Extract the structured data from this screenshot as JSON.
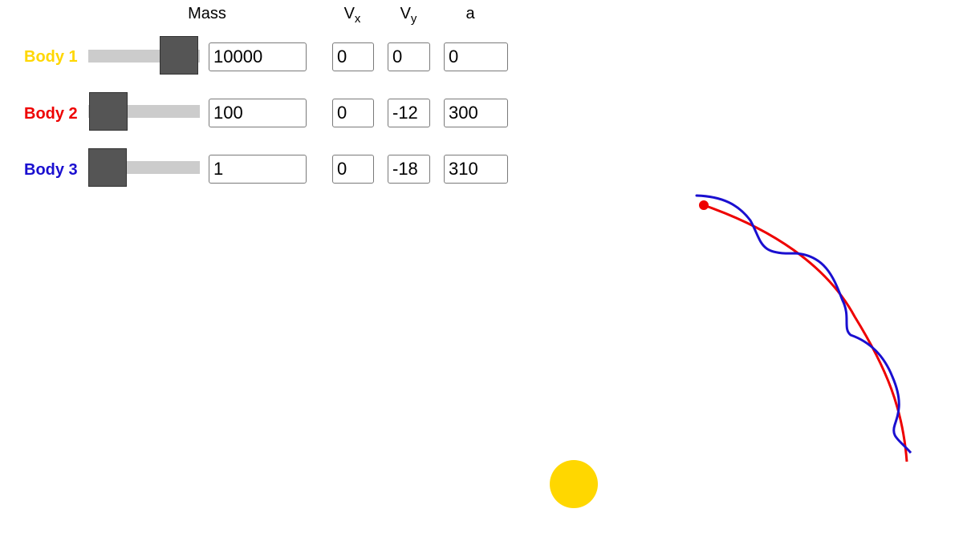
{
  "headers": {
    "mass": "Mass",
    "vx_main": "V",
    "vx_sub": "x",
    "vy_main": "V",
    "vy_sub": "y",
    "a": "a"
  },
  "bodies": [
    {
      "label": "Body 1",
      "color": "#FFD700",
      "mass": "10000",
      "vx": "0",
      "vy": "0",
      "a": "0",
      "mass_slider": 1.0
    },
    {
      "label": "Body 2",
      "color": "#EE0000",
      "mass": "100",
      "vx": "0",
      "vy": "-12",
      "a": "300",
      "mass_slider": 0.0
    },
    {
      "label": "Body 3",
      "color": "#1A0FD0",
      "mass": "1",
      "vx": "0",
      "vy": "-18",
      "a": "310",
      "mass_slider": 0.0
    }
  ]
}
